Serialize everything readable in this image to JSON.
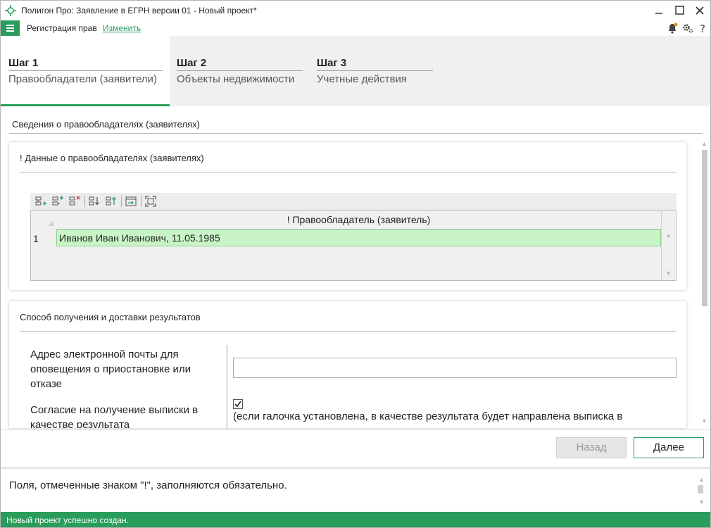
{
  "window": {
    "title": "Полигон Про: Заявление в ЕГРН версии 01 - Новый проект*"
  },
  "menu": {
    "section": "Регистрация прав",
    "change_link": "Изменить"
  },
  "steps": [
    {
      "num": "Шаг 1",
      "name": "Правообладатели (заявители)",
      "active": true
    },
    {
      "num": "Шаг 2",
      "name": "Объекты недвижимости",
      "active": false
    },
    {
      "num": "Шаг 3",
      "name": "Учетные действия",
      "active": false
    }
  ],
  "content": {
    "section_title": "Сведения о правообладателях (заявителях)",
    "holders_card": {
      "title": "! Данные о правообладателях (заявителях)",
      "grid": {
        "column_header": "! Правообладатель (заявитель)",
        "rows": [
          {
            "num": "1",
            "value": "Иванов Иван Иванович, 11.05.1985"
          }
        ]
      }
    },
    "delivery_card": {
      "title": "Способ получения и доставки результатов",
      "email_label": "Адрес электронной почты для оповещения о приостановке или отказе",
      "email_value": "",
      "consent_label": "Согласие на получение выписки в качестве результата",
      "consent_checked": true,
      "consent_hint": "(если галочка установлена, в качестве результата будет направлена выписка в"
    }
  },
  "buttons": {
    "back": "Назад",
    "next": "Далее"
  },
  "info": {
    "text": "Поля, отмеченные знаком \"!\", заполняются обязательно."
  },
  "status": {
    "text": "Новый проект успешно создан."
  },
  "colors": {
    "accent": "#2a9d5c",
    "row_highlight": "#c9f5c6"
  }
}
